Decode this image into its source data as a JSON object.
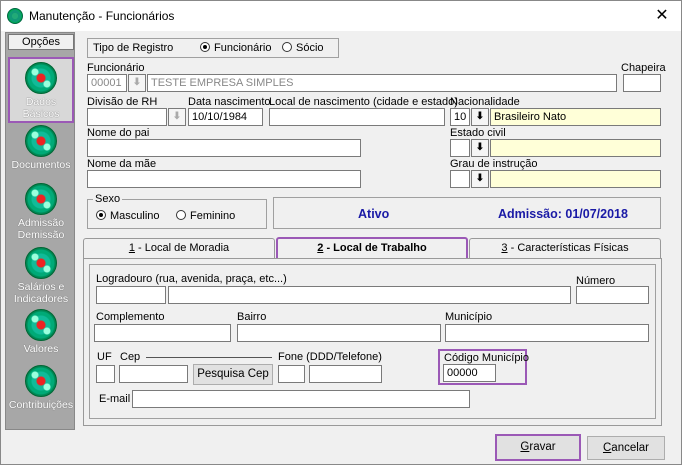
{
  "window": {
    "title": "Manutenção - Funcionários",
    "close_glyph": "✕"
  },
  "sidebar": {
    "header": "Opções",
    "items": [
      {
        "label": "Dados Básicos",
        "icon": "globe-icon"
      },
      {
        "label": "Documentos",
        "icon": "globe-icon"
      },
      {
        "label": "Admissão Demissão",
        "icon": "globe-icon"
      },
      {
        "label": "Salários e Indicadores",
        "icon": "globe-icon"
      },
      {
        "label": "Valores",
        "icon": "globe-icon"
      },
      {
        "label": "Contribuições",
        "icon": "globe-icon"
      }
    ]
  },
  "registro": {
    "label": "Tipo de Registro",
    "opt1": "Funcionário",
    "opt2": "Sócio"
  },
  "funcionario": {
    "label": "Funcionário",
    "code": "00001",
    "name": "TESTE EMPRESA SIMPLES",
    "chapeira_label": "Chapeira",
    "chapeira_value": ""
  },
  "divisao": {
    "label": "Divisão de RH",
    "value": ""
  },
  "nascimento": {
    "label": "Data nascimento",
    "value": "10/10/1984"
  },
  "local_nasc": {
    "label": "Local de nascimento (cidade e estado)",
    "value": ""
  },
  "nacionalidade": {
    "label": "Nacionalidade",
    "code": "10",
    "value": "Brasileiro Nato"
  },
  "pai": {
    "label": "Nome do pai",
    "value": ""
  },
  "estado_civil": {
    "label": "Estado civil",
    "code": "",
    "value": ""
  },
  "mae": {
    "label": "Nome da mãe",
    "value": ""
  },
  "grau": {
    "label": "Grau de instrução",
    "code": "",
    "value": ""
  },
  "sexo": {
    "label": "Sexo",
    "opt1": "Masculino",
    "opt2": "Feminino"
  },
  "status": {
    "situacao": "Ativo",
    "admissao": "Admissão: 01/07/2018"
  },
  "tabs": [
    {
      "num": "1",
      "label": " - Local de Moradia"
    },
    {
      "num": "2",
      "label": " - Local de Trabalho"
    },
    {
      "num": "3",
      "label": " - Características Físicas"
    }
  ],
  "trabalho": {
    "logradouro_label": "Logradouro (rua, avenida, praça, etc...)",
    "numero_label": "Número",
    "complemento_label": "Complemento",
    "bairro_label": "Bairro",
    "municipio_label": "Município",
    "uf_label": "UF",
    "cep_label": "Cep",
    "pesquisa_cep": "Pesquisa Cep",
    "fone_label": "Fone (DDD/Telefone)",
    "codigo_municipio_label": "Código Município",
    "codigo_municipio_value": "00000",
    "email_label": "E-mail"
  },
  "actions": {
    "gravar_u": "G",
    "gravar_rest": "ravar",
    "cancelar_u": "C",
    "cancelar_rest": "ancelar"
  },
  "download_glyph": "⬇",
  "colors": {
    "highlight": "#9b59b6",
    "status_blue": "#1a1aa6",
    "yellow_field": "#ffffd8"
  }
}
